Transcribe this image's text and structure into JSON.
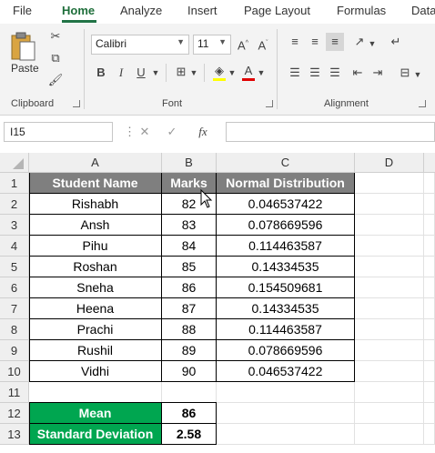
{
  "ribbon_tabs": [
    "File",
    "Home",
    "Analyze",
    "Insert",
    "Page Layout",
    "Formulas",
    "Data"
  ],
  "active_tab": "Home",
  "clipboard": {
    "paste_label": "Paste",
    "group_label": "Clipboard"
  },
  "font": {
    "name": "Calibri",
    "size": "11",
    "group_label": "Font",
    "bold_label": "B",
    "italic_label": "I",
    "underline_label": "U"
  },
  "alignment": {
    "group_label": "Alignment"
  },
  "formula_bar": {
    "name_box": "I15",
    "fx_label": "fx",
    "value": ""
  },
  "columns": [
    "A",
    "B",
    "C",
    "D"
  ],
  "rows": [
    "1",
    "2",
    "3",
    "4",
    "5",
    "6",
    "7",
    "8",
    "9",
    "10",
    "11",
    "12",
    "13"
  ],
  "table": {
    "headers": [
      "Student Name",
      "Marks",
      "Normal Distribution"
    ],
    "rows": [
      [
        "Rishabh",
        "82",
        "0.046537422"
      ],
      [
        "Ansh",
        "83",
        "0.078669596"
      ],
      [
        "Pihu",
        "84",
        "0.114463587"
      ],
      [
        "Roshan",
        "85",
        "0.14334535"
      ],
      [
        "Sneha",
        "86",
        "0.154509681"
      ],
      [
        "Heena",
        "87",
        "0.14334535"
      ],
      [
        "Prachi",
        "88",
        "0.114463587"
      ],
      [
        "Rushil",
        "89",
        "0.078669596"
      ],
      [
        "Vidhi",
        "90",
        "0.046537422"
      ]
    ]
  },
  "stats": [
    {
      "label": "Mean",
      "value": "86"
    },
    {
      "label": "Standard Deviation",
      "value": "2.58"
    }
  ],
  "colors": {
    "accent": "#217346",
    "header_fill": "#7f7f7f",
    "stat_fill": "#00a650"
  }
}
